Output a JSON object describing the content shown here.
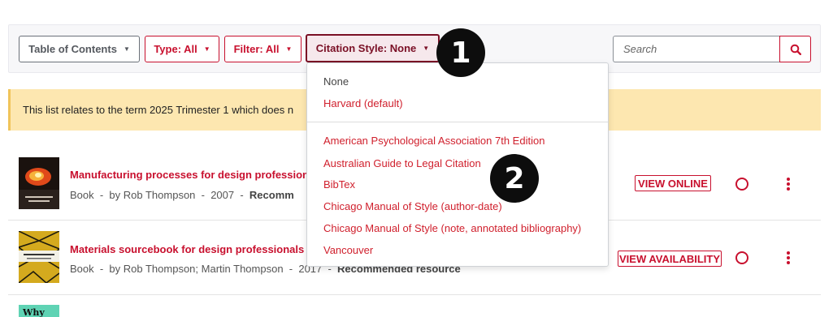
{
  "toolbar": {
    "toc_label": "Table of Contents",
    "type_label": "Type: All",
    "filter_label": "Filter: All",
    "citation_label": "Citation Style: None",
    "search_placeholder": "Search"
  },
  "notice": {
    "text": "This list relates to the term 2025 Trimester 1 which does n"
  },
  "citation_menu": {
    "group1": [
      "None",
      "Harvard (default)"
    ],
    "group2": [
      "American Psychological Association 7th Edition",
      "Australian Guide to Legal Citation",
      "BibTex",
      "Chicago Manual of Style (author-date)",
      "Chicago Manual of Style (note, annotated bibliography)",
      "Vancouver"
    ]
  },
  "markers": [
    "1",
    "2"
  ],
  "resources": [
    {
      "title": "Manufacturing processes for design profession",
      "type": "Book",
      "author": "by Rob Thompson",
      "year": "2007",
      "status": "Recomm",
      "action": "VIEW ONLINE"
    },
    {
      "title": "Materials sourcebook for design professionals",
      "type": "Book",
      "author": "by Rob Thompson; Martin Thompson",
      "year": "2017",
      "status": "Recommended resource",
      "action": "VIEW AVAILABILITY"
    }
  ],
  "third_thumb_text": "Why",
  "colors": {
    "accent_red": "#c8102e",
    "active_maroon": "#7a0f25",
    "notice_bg": "#fde7b0"
  }
}
